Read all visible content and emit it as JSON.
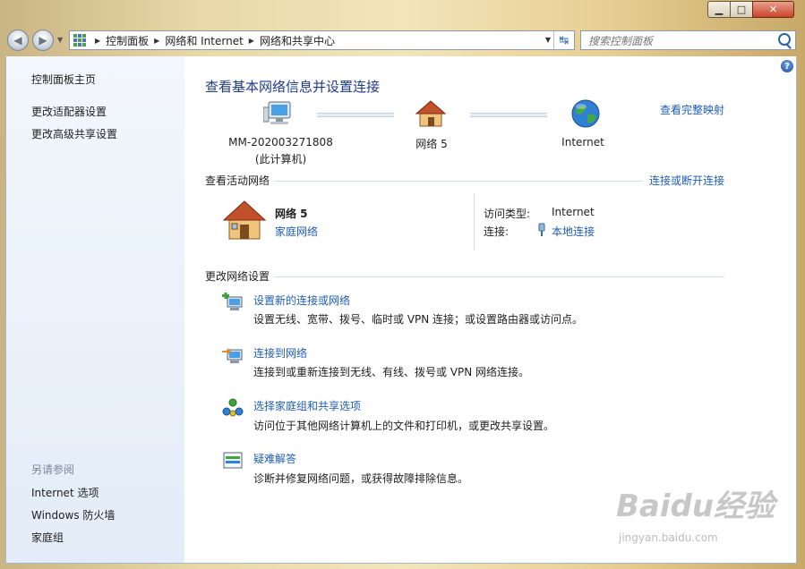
{
  "window": {
    "minimize_glyph": "▁",
    "maximize_glyph": "□",
    "close_glyph": "✕"
  },
  "nav": {
    "back_glyph": "◀",
    "forward_glyph": "▶",
    "breadcrumbs": [
      "控制面板",
      "网络和 Internet",
      "网络和共享中心"
    ],
    "search_placeholder": "搜索控制面板",
    "refresh_glyph": "↹"
  },
  "sidebar": {
    "items": [
      "控制面板主页",
      "更改适配器设置",
      "更改高级共享设置"
    ],
    "see_also_title": "另请参阅",
    "see_also_items": [
      "Internet 选项",
      "Windows 防火墙",
      "家庭组"
    ]
  },
  "main": {
    "title": "查看基本网络信息并设置连接",
    "view_full_map": "查看完整映射",
    "map": {
      "computer_name": "MM-202003271808",
      "computer_sub": "(此计算机)",
      "network": "网络  5",
      "internet": "Internet"
    },
    "active_networks": {
      "heading": "查看活动网络",
      "connect_link": "连接或断开连接",
      "network_name": "网络  5",
      "network_type": "家庭网络",
      "access_type_label": "访问类型:",
      "access_type_value": "Internet",
      "connection_label": "连接:",
      "connection_value": "本地连接"
    },
    "change_settings": {
      "heading": "更改网络设置",
      "tasks": [
        {
          "title": "设置新的连接或网络",
          "desc": "设置无线、宽带、拨号、临时或 VPN 连接；或设置路由器或访问点。",
          "icon": "setup-connection-icon"
        },
        {
          "title": "连接到网络",
          "desc": "连接到或重新连接到无线、有线、拨号或 VPN 网络连接。",
          "icon": "connect-network-icon"
        },
        {
          "title": "选择家庭组和共享选项",
          "desc": "访问位于其他网络计算机上的文件和打印机，或更改共享设置。",
          "icon": "homegroup-icon"
        },
        {
          "title": "疑难解答",
          "desc": "诊断并修复网络问题，或获得故障排除信息。",
          "icon": "troubleshoot-icon"
        }
      ]
    }
  },
  "watermark": {
    "logo": "Baidu经验",
    "url": "jingyan.baidu.com"
  },
  "colors": {
    "link": "#1f5db5",
    "title": "#1e3a8a",
    "sidebar_bg": "#e3ecf8"
  }
}
